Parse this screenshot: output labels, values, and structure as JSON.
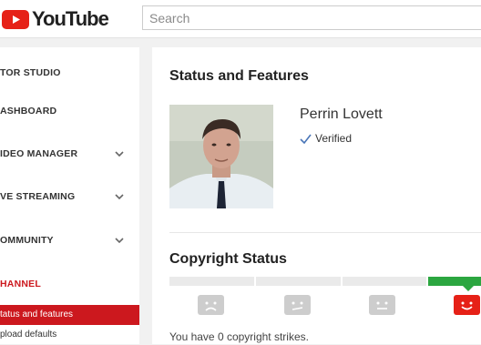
{
  "header": {
    "logo_text": "YouTube",
    "search_placeholder": "Search"
  },
  "sidebar": {
    "items": [
      {
        "label": "TOR STUDIO"
      },
      {
        "label": "ASHBOARD"
      },
      {
        "label": "IDEO MANAGER"
      },
      {
        "label": "VE STREAMING"
      },
      {
        "label": "OMMUNITY"
      },
      {
        "label": "HANNEL"
      }
    ],
    "subitems": [
      {
        "label": "tatus and features",
        "active": true
      },
      {
        "label": "pload defaults",
        "active": false
      }
    ]
  },
  "main": {
    "title": "Status and Features",
    "channel_name": "Perrin Lovett",
    "verified_label": "Verified",
    "copyright_title": "Copyright Status",
    "strikes_text": "You have 0 copyright strikes."
  },
  "colors": {
    "brand_red": "#cc181e",
    "good_green": "#2ba640"
  }
}
